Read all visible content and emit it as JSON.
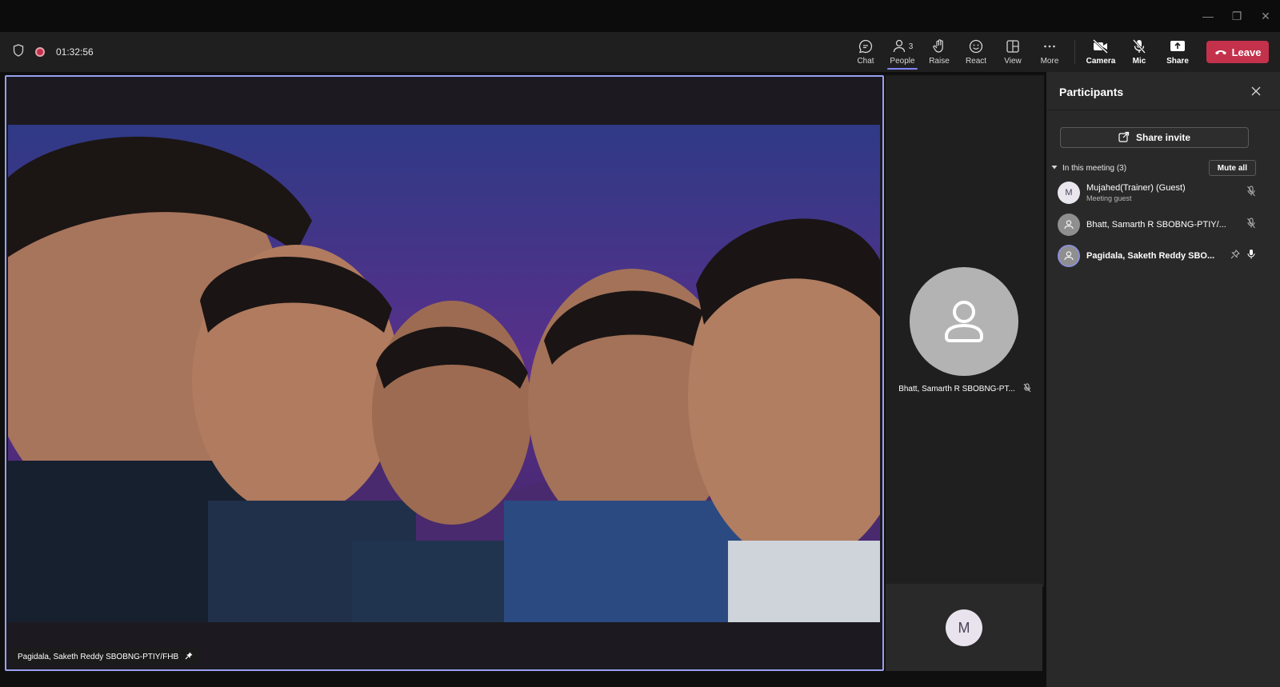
{
  "window": {
    "minimize": "—",
    "restore": "❐",
    "close": "✕"
  },
  "meeting": {
    "timer": "01:32:56"
  },
  "toolbar": {
    "chat": "Chat",
    "people": "People",
    "people_count": "3",
    "raise": "Raise",
    "react": "React",
    "view": "View",
    "more": "More",
    "camera": "Camera",
    "mic": "Mic",
    "share": "Share",
    "leave": "Leave"
  },
  "stage": {
    "main_tile_name": "Pagidala, Saketh Reddy SBOBNG-PTIY/FHB",
    "side_tile_name": "Bhatt, Samarth R SBOBNG-PT...",
    "bottom_tile_initial": "M"
  },
  "panel": {
    "title": "Participants",
    "share_invite": "Share invite",
    "section_label": "In this meeting (3)",
    "mute_all": "Mute all",
    "participants": [
      {
        "initial": "M",
        "name": "Mujahed(Trainer) (Guest)",
        "sub": "Meeting guest"
      },
      {
        "name": "Bhatt, Samarth R SBOBNG-PTIY/..."
      },
      {
        "name": "Pagidala, Saketh Reddy SBO..."
      }
    ]
  },
  "colors": {
    "accent": "#7f85f5",
    "leave": "#c4314b",
    "panel": "#292929",
    "toolbar": "#1f1f1f"
  }
}
